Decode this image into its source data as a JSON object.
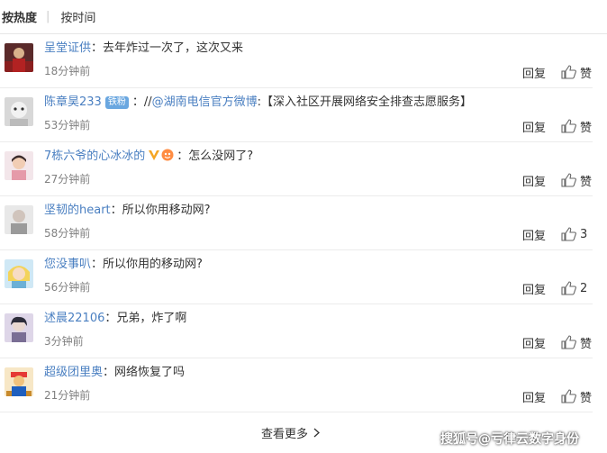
{
  "tabs": {
    "hot": "按热度",
    "time": "按时间"
  },
  "comments": [
    {
      "user": "呈堂证供",
      "text": "去年炸过一次了，这次又来",
      "time": "18分钟前",
      "reply": "回复",
      "like": "赞"
    },
    {
      "user": "陈章昊233",
      "badge": "铁粉",
      "text_prefix": "//",
      "mention": "@湖南电信官方微博",
      "text": ":【深入社区开展网络安全排查志愿服务】",
      "time": "53分钟前",
      "reply": "回复",
      "like": "赞"
    },
    {
      "user": "7栋六爷的心冰冰的",
      "text": "怎么没网了?",
      "time": "27分钟前",
      "reply": "回复",
      "like": "赞"
    },
    {
      "user": "坚韧的heart",
      "text": "所以你用移动网?",
      "time": "58分钟前",
      "reply": "回复",
      "like": "3"
    },
    {
      "user": "您没事叭",
      "text": "所以你用的移动网?",
      "time": "56分钟前",
      "reply": "回复",
      "like": "2"
    },
    {
      "user": "述晨22106",
      "text": "兄弟，炸了啊",
      "time": "3分钟前",
      "reply": "回复",
      "like": "赞"
    },
    {
      "user": "超级团里奥",
      "text": "网络恢复了吗",
      "time": "21分钟前",
      "reply": "回复",
      "like": "赞"
    }
  ],
  "more": "查看更多",
  "watermark": "搜狐号@亏律云数字身份",
  "colors": {
    "username": "#4a7fc1",
    "time": "#808080",
    "badge": "#6aa7e0"
  }
}
